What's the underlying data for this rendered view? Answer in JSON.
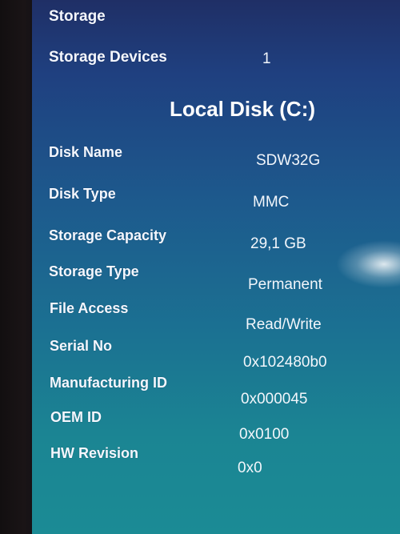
{
  "section_title": "Storage",
  "storage_devices": {
    "label": "Storage Devices",
    "value": "1"
  },
  "disk_heading": "Local Disk (C:)",
  "rows": [
    {
      "label": "Disk Name",
      "value": "SDW32G"
    },
    {
      "label": "Disk Type",
      "value": "MMC"
    },
    {
      "label": "Storage Capacity",
      "value": "29,1 GB"
    },
    {
      "label": "Storage Type",
      "value": "Permanent"
    },
    {
      "label": "File Access",
      "value": "Read/Write"
    },
    {
      "label": "Serial No",
      "value": "0x102480b0"
    },
    {
      "label": "Manufacturing ID",
      "value": "0x000045"
    },
    {
      "label": "OEM ID",
      "value": "0x0100"
    },
    {
      "label": "HW Revision",
      "value": "0x0"
    }
  ]
}
